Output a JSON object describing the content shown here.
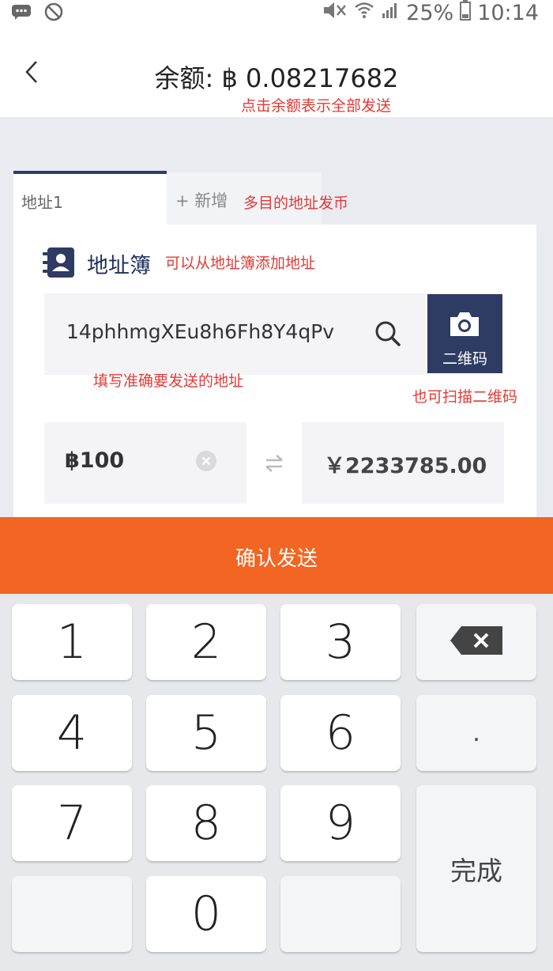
{
  "status_bar": {
    "battery_percent": "25%",
    "time": "10:14"
  },
  "header": {
    "balance": "余额: ฿ 0.08217682",
    "balance_note": "点击余额表示全部发送"
  },
  "tabs": [
    {
      "label": "地址1",
      "active": true
    },
    {
      "label": "+ 新增",
      "active": false
    }
  ],
  "tabs_note": "多目的地址发币",
  "address_book": {
    "label": "地址簿",
    "note": "可以从地址簿添加地址"
  },
  "address": {
    "value": "14phhmgXEu8h6Fh8Y4qPv",
    "note": "填写准确要发送的地址"
  },
  "qr": {
    "label": "二维码",
    "note": "也可扫描二维码"
  },
  "amount": {
    "btc": "฿100",
    "cny": "￥2233785.00"
  },
  "confirm_label": "确认发送",
  "keypad": {
    "k1": "1",
    "k2": "2",
    "k3": "3",
    "k4": "4",
    "k5": "5",
    "k6": "6",
    "k7": "7",
    "k8": "8",
    "k9": "9",
    "k0": "0",
    "dot": ".",
    "done": "完成"
  },
  "colors": {
    "accent": "#f26522",
    "navy": "#2e3b63",
    "annotation": "#e53935"
  }
}
